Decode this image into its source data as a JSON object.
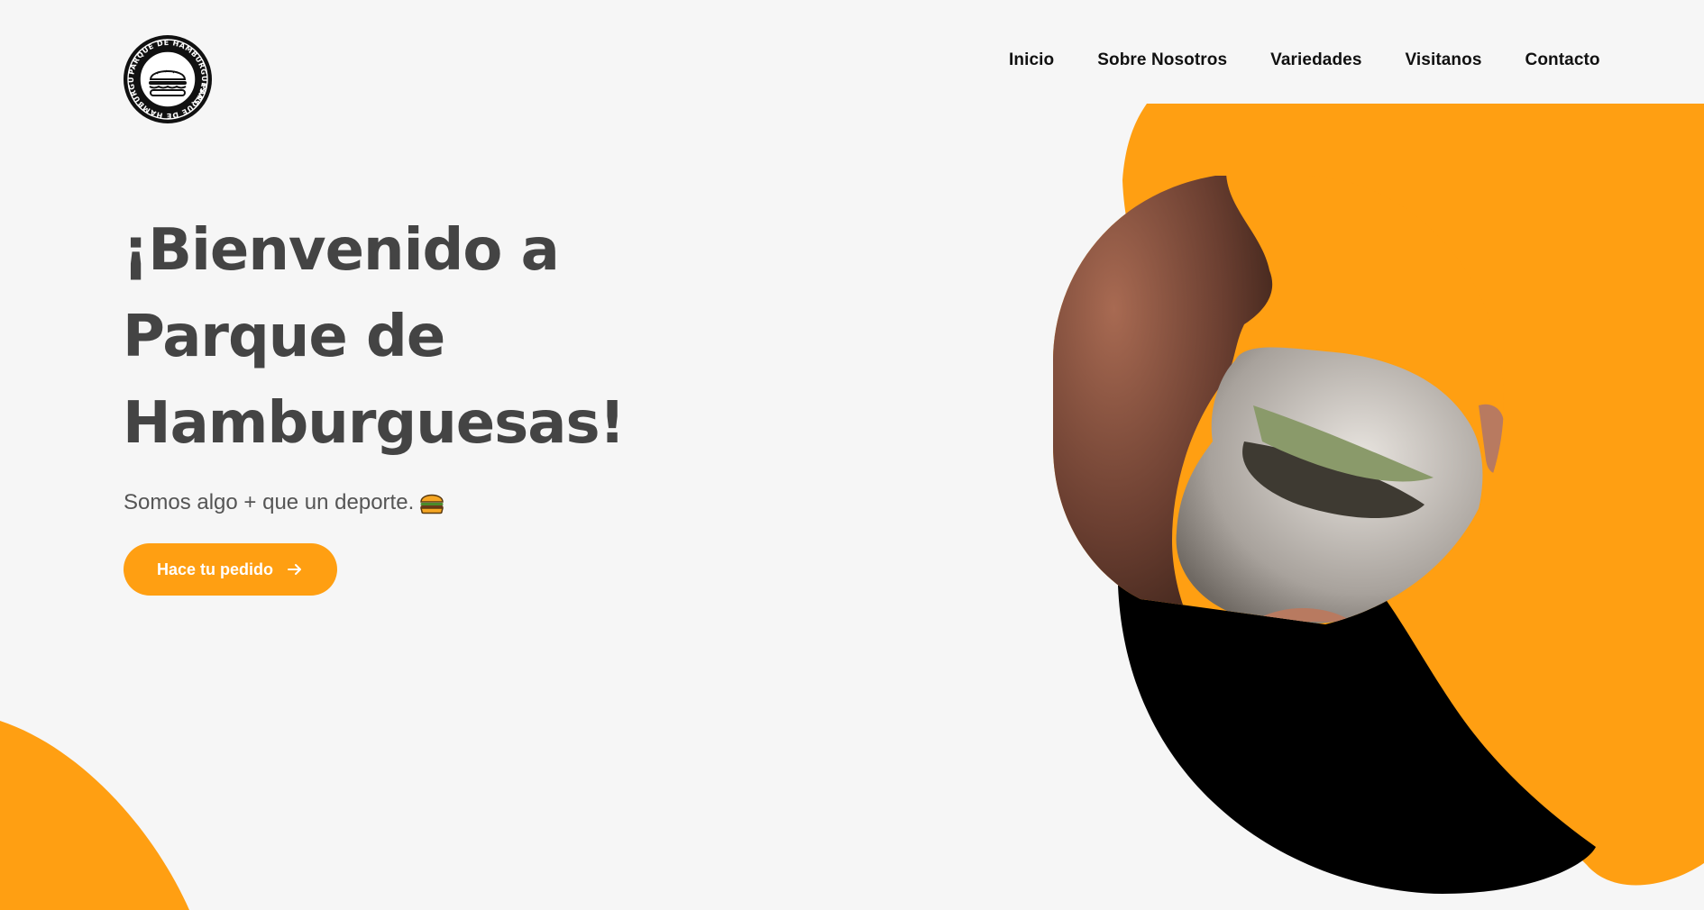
{
  "brand": {
    "logo_ring_text": "PARQUE DE HAMBURGUESAS"
  },
  "nav": {
    "items": [
      {
        "label": "Inicio"
      },
      {
        "label": "Sobre Nosotros"
      },
      {
        "label": "Variedades"
      },
      {
        "label": "Visitanos"
      },
      {
        "label": "Contacto"
      }
    ]
  },
  "hero": {
    "title_line1": "¡Bienvenido a",
    "title_line2": "Parque de",
    "title_line3": "Hamburguesas!",
    "subtitle": "Somos algo + que un deporte.",
    "cta_label": "Hace tu pedido"
  },
  "colors": {
    "accent": "#ff9f12",
    "background": "#f6f6f6",
    "text_dark": "#444444"
  }
}
